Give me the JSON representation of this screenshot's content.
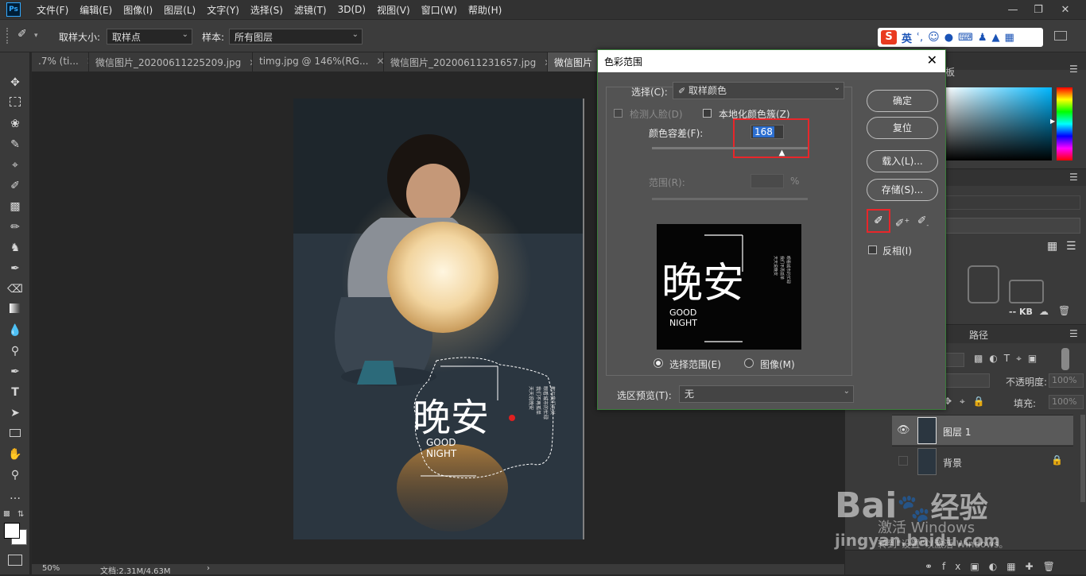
{
  "app": {
    "logo": "Ps"
  },
  "menu": [
    "文件(F)",
    "编辑(E)",
    "图像(I)",
    "图层(L)",
    "文字(Y)",
    "选择(S)",
    "滤镜(T)",
    "3D(D)",
    "视图(V)",
    "窗口(W)",
    "帮助(H)"
  ],
  "options": {
    "sample_size_label": "取样大小:",
    "sample_size_value": "取样点",
    "sample_label": "样本:",
    "sample_value": "所有图层"
  },
  "ime": {
    "lang": "英"
  },
  "tabs": [
    {
      "label": ".7% (ti..."
    },
    {
      "label": "微信图片_20200611225209.jpg"
    },
    {
      "label": "timg.jpg @ 146%(RG..."
    },
    {
      "label": "微信图片_20200611231657.jpg"
    },
    {
      "label": "微信图片"
    }
  ],
  "photo": {
    "title_cn": "晚安",
    "good": "GOOD",
    "night": "NIGHT",
    "side_text_1": "天天说晚安",
    "side_text_2": "我们不再孤单",
    "side_text_3": "眼看城市的忙碌",
    "side_text_4": "都与我们无关"
  },
  "status": {
    "zoom": "50%",
    "doc": "文档:2.31M/4.63M"
  },
  "dialog": {
    "title": "色彩范围",
    "select_label": "选择(C):",
    "select_value": "取样颜色",
    "detect_faces": "检测人脸(D)",
    "localized": "本地化颜色簇(Z)",
    "fuzziness_label": "颜色容差(F):",
    "fuzziness_value": "168",
    "fuzziness_fraction": 0.84,
    "range_label": "范围(R):",
    "range_unit": "%",
    "radio_selection": "选择范围(E)",
    "radio_image": "图像(M)",
    "preview_label": "选区预览(T):",
    "preview_value": "无",
    "ok": "确定",
    "reset": "复位",
    "load": "载入(L)...",
    "save": "存储(S)...",
    "invert": "反相(I)"
  },
  "panels": {
    "color_tab_suffix": "板",
    "kb": "-- KB",
    "paths_tab": "路径",
    "opacity_label": "不透明度:",
    "opacity_value": "100%",
    "fill_label": "填充:",
    "fill_value": "100%",
    "layers": [
      {
        "name": "图层 1"
      },
      {
        "name": "背景"
      }
    ]
  },
  "watermark": {
    "activate": "激活 Windows",
    "activate_sub": "转到\"设置\"以激活 Windows。",
    "baidu": "Bai",
    "baidu_cn": "经验",
    "url": "jingyan.baidu.com"
  }
}
